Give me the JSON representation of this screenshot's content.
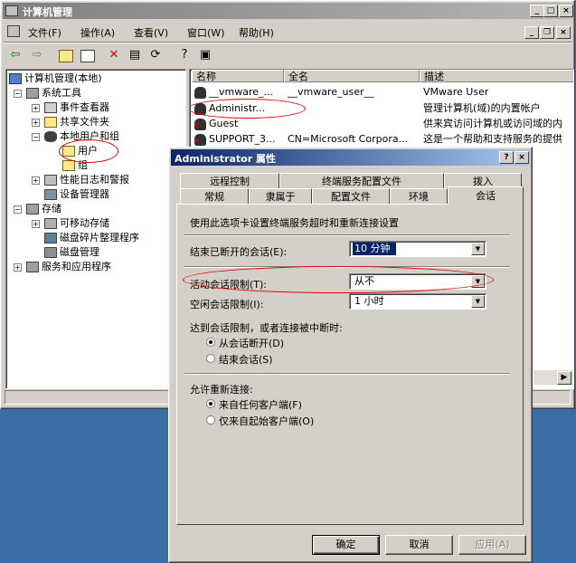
{
  "main_window": {
    "title": "计算机管理",
    "menu": [
      "文件(F)",
      "操作(A)",
      "查看(V)",
      "窗口(W)",
      "帮助(H)"
    ],
    "tree": [
      {
        "label": "计算机管理(本地)",
        "icon": "computer-icon"
      },
      {
        "label": "系统工具",
        "icon": "tools-icon"
      },
      {
        "label": "事件查看器",
        "icon": "event-viewer-icon"
      },
      {
        "label": "共享文件夹",
        "icon": "folder-icon"
      },
      {
        "label": "本地用户和组",
        "icon": "users-icon"
      },
      {
        "label": "用户",
        "icon": "folder-open-icon"
      },
      {
        "label": "组",
        "icon": "folder-icon"
      },
      {
        "label": "性能日志和警报",
        "icon": "perf-icon"
      },
      {
        "label": "设备管理器",
        "icon": "device-icon"
      },
      {
        "label": "存储",
        "icon": "storage-icon"
      },
      {
        "label": "可移动存储",
        "icon": "removable-icon"
      },
      {
        "label": "磁盘碎片整理程序",
        "icon": "defrag-icon"
      },
      {
        "label": "磁盘管理",
        "icon": "disk-icon"
      },
      {
        "label": "服务和应用程序",
        "icon": "services-icon"
      }
    ],
    "list_headers": [
      "名称",
      "全名",
      "描述"
    ],
    "list_rows": [
      {
        "name": "__vmware_...",
        "fullname": "__vmware_user__",
        "desc": "VMware User"
      },
      {
        "name": "Administr...",
        "fullname": "",
        "desc": "管理计算机(域)的内置帐户"
      },
      {
        "name": "Guest",
        "fullname": "",
        "desc": "供来宾访问计算机或访问域的内"
      },
      {
        "name": "SUPPORT_3...",
        "fullname": "CN=Microsoft Corpora...",
        "desc": "这是一个帮助和支持服务的提供"
      }
    ]
  },
  "dialog": {
    "title": "Administrator 属性",
    "tabs_row1": [
      "远程控制",
      "终端服务配置文件",
      "拨入"
    ],
    "tabs_row2": [
      "常规",
      "隶属于",
      "配置文件",
      "环境",
      "会话"
    ],
    "intro": "使用此选项卡设置终端服务超时和重新连接设置",
    "end_disconnected_label": "结束已断开的会话(E):",
    "end_disconnected_value": "10 分钟",
    "active_limit_label": "活动会话限制(T):",
    "active_limit_value": "从不",
    "idle_limit_label": "空闲会话限制(I):",
    "idle_limit_value": "1 小时",
    "reach_limit_label": "达到会话限制，或者连接被中断时:",
    "reach_opt1": "从会话断开(D)",
    "reach_opt2": "结束会话(S)",
    "reconnect_label": "允许重新连接:",
    "reconnect_opt1": "来自任何客户端(F)",
    "reconnect_opt2": "仅来自起始客户端(O)",
    "ok": "确定",
    "cancel": "取消",
    "apply": "应用(A)"
  }
}
